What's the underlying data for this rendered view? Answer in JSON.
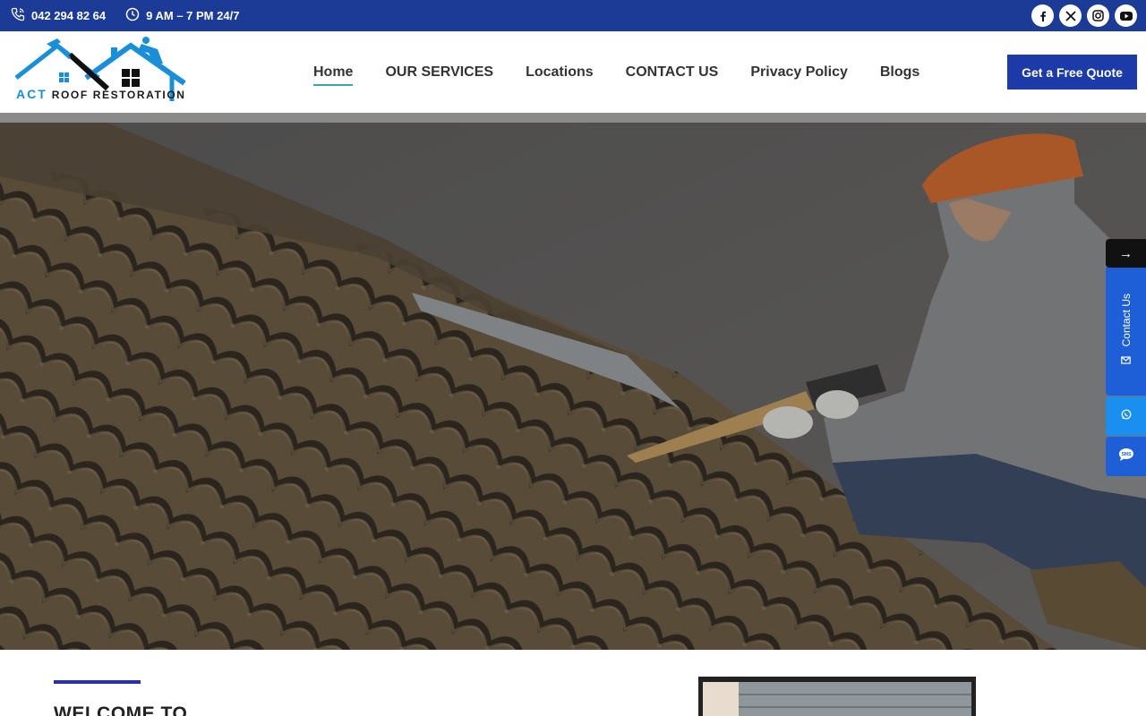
{
  "topbar": {
    "phone": "042 294 82 64",
    "hours": "9 AM – 7 PM 24/7",
    "socials": [
      "facebook-icon",
      "x-icon",
      "instagram-icon",
      "youtube-icon"
    ]
  },
  "header": {
    "logo_act": "ACT",
    "logo_rest": "ROOF RESTORATION",
    "nav": [
      "Home",
      "OUR SERVICES",
      "Locations",
      "CONTACT US",
      "Privacy Policy",
      "Blogs"
    ],
    "active_nav": "Home",
    "cta": "Get a Free Quote"
  },
  "side_widget": {
    "arrow": "→",
    "contact_label": "Contact Us"
  },
  "welcome": {
    "heading": "WELCOME TO"
  },
  "colors": {
    "topbar": "#1c3b96",
    "cta": "#1c3ba8",
    "active_underline": "#3aa9a6",
    "side_blue": "#1e5fd8"
  }
}
